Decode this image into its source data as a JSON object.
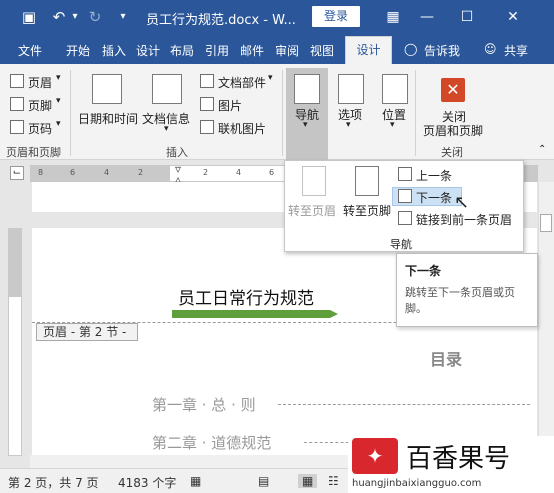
{
  "titlebar": {
    "title": "员工行为规范.docx - W...",
    "login": "登录",
    "icons": [
      "save-icon",
      "undo-icon",
      "redo-icon",
      "customize-icon"
    ]
  },
  "tabs": [
    "文件",
    "开始",
    "插入",
    "设计",
    "布局",
    "引用",
    "邮件",
    "审阅",
    "视图"
  ],
  "active_tab": "设计",
  "tell_me": "告诉我",
  "share": "共享",
  "ribbon": {
    "header_group": {
      "items": [
        "页眉",
        "页脚",
        "页码"
      ],
      "label": "页眉和页脚"
    },
    "insert_group": {
      "datetime": "日期和时间",
      "docinfo": "文档信息",
      "quickparts": "文档部件",
      "picture": "图片",
      "online_picture": "联机图片",
      "label": "插入"
    },
    "nav": "导航",
    "options": "选项",
    "position": "位置",
    "close_line1": "关闭",
    "close_line2": "页眉和页脚",
    "close_group": "关闭"
  },
  "ruler": {
    "nums": [
      "8",
      "6",
      "4",
      "2",
      "2",
      "4",
      "6",
      "8"
    ]
  },
  "dropdown": {
    "goto_header": "转至页眉",
    "goto_footer": "转至页脚",
    "previous": "上一条",
    "next": "下一条",
    "link_previous": "链接到前一条页眉",
    "group_label": "导航"
  },
  "tooltip": {
    "title": "下一条",
    "body": "跳转至下一条页眉或页脚。"
  },
  "document": {
    "heading": "员工日常行为规范",
    "header_tag": "页眉 - 第 2 节 -",
    "toc_title": "目录",
    "toc_1": "第一章 · 总 · 则",
    "toc_2": "第二章 · 道德规范"
  },
  "status": {
    "page": "第 2 页，共 7 页",
    "words": "4183 个字"
  },
  "watermark": {
    "text": "百香果号",
    "url": "huangjinbaixiangguo.com"
  },
  "colors": {
    "brand": "#2b579a",
    "close": "#d24726",
    "arrow": "#5e9f3c"
  }
}
